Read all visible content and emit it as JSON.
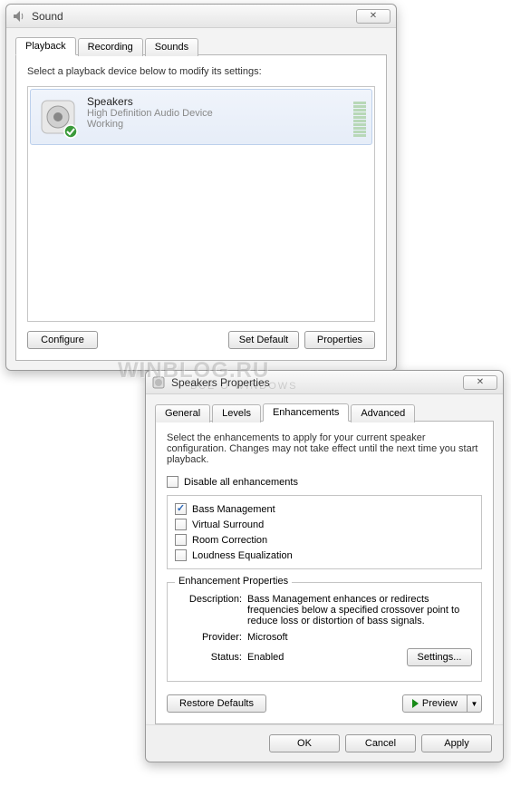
{
  "watermark": {
    "main": "WINBLOG.RU",
    "sub": "ВСЕ О WINDOWS"
  },
  "sound_window": {
    "title": "Sound",
    "tabs": [
      "Playback",
      "Recording",
      "Sounds"
    ],
    "active_tab": 0,
    "instruction": "Select a playback device below to modify its settings:",
    "device": {
      "name": "Speakers",
      "sub": "High Definition Audio Device",
      "status": "Working"
    },
    "buttons": {
      "configure": "Configure",
      "set_default": "Set Default",
      "properties": "Properties"
    }
  },
  "props_window": {
    "title": "Speakers Properties",
    "tabs": [
      "General",
      "Levels",
      "Enhancements",
      "Advanced"
    ],
    "active_tab": 2,
    "instruction": "Select the enhancements to apply for your current speaker configuration. Changes may not take effect until the next time you start playback.",
    "disable_all_label": "Disable all enhancements",
    "disable_all_checked": false,
    "enhancements": [
      {
        "label": "Bass Management",
        "checked": true
      },
      {
        "label": "Virtual Surround",
        "checked": false
      },
      {
        "label": "Room Correction",
        "checked": false
      },
      {
        "label": "Loudness Equalization",
        "checked": false
      }
    ],
    "enh_props": {
      "group_title": "Enhancement Properties",
      "description_label": "Description:",
      "description": "Bass Management enhances or redirects frequencies below a specified crossover point to reduce loss or distortion of bass signals.",
      "provider_label": "Provider:",
      "provider": "Microsoft",
      "status_label": "Status:",
      "status": "Enabled",
      "settings_btn": "Settings..."
    },
    "restore_defaults": "Restore Defaults",
    "preview": "Preview",
    "ok": "OK",
    "cancel": "Cancel",
    "apply": "Apply"
  }
}
